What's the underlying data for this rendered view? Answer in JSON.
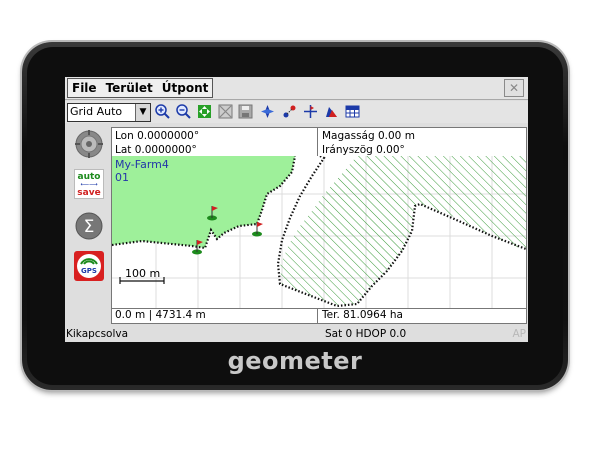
{
  "brand": "geometer",
  "menu": {
    "items": [
      "File",
      "Terület",
      "Útpont"
    ]
  },
  "toolbar": {
    "grid_select": "Grid Auto",
    "icons": [
      "zoom-in-icon",
      "zoom-out-icon",
      "pan-icon",
      "zoom-extent-icon",
      "save-icon",
      "navigate-icon",
      "waypoint-icon",
      "compass-icon",
      "layers-icon",
      "grid-icon"
    ]
  },
  "left_panel": [
    "gps-target-icon",
    "autosave-icon",
    "sum-icon",
    "gps-signal-icon"
  ],
  "autosave_label": {
    "top": "auto",
    "bottom": "save"
  },
  "gps_label": "GPS",
  "info": {
    "lon": "Lon 0.0000000°",
    "lat": "Lat 0.0000000°",
    "altitude": "Magasság 0.00 m",
    "heading": "Irányszög 0.00°"
  },
  "map": {
    "farm_name": "My-Farm4",
    "field_id": "01",
    "scale_label": "100 m"
  },
  "status": {
    "distance": "0.0 m | 4731.4 m",
    "area": "Ter. 81.0964 ha"
  },
  "bottom": {
    "connection": "Kikapcsolva",
    "satellites": "Sat 0 HDOP 0.0",
    "corner": "AP"
  },
  "colors": {
    "field_fill": "#9ef09a",
    "hatch": "#3a9a3a",
    "label": "#2436a8"
  }
}
